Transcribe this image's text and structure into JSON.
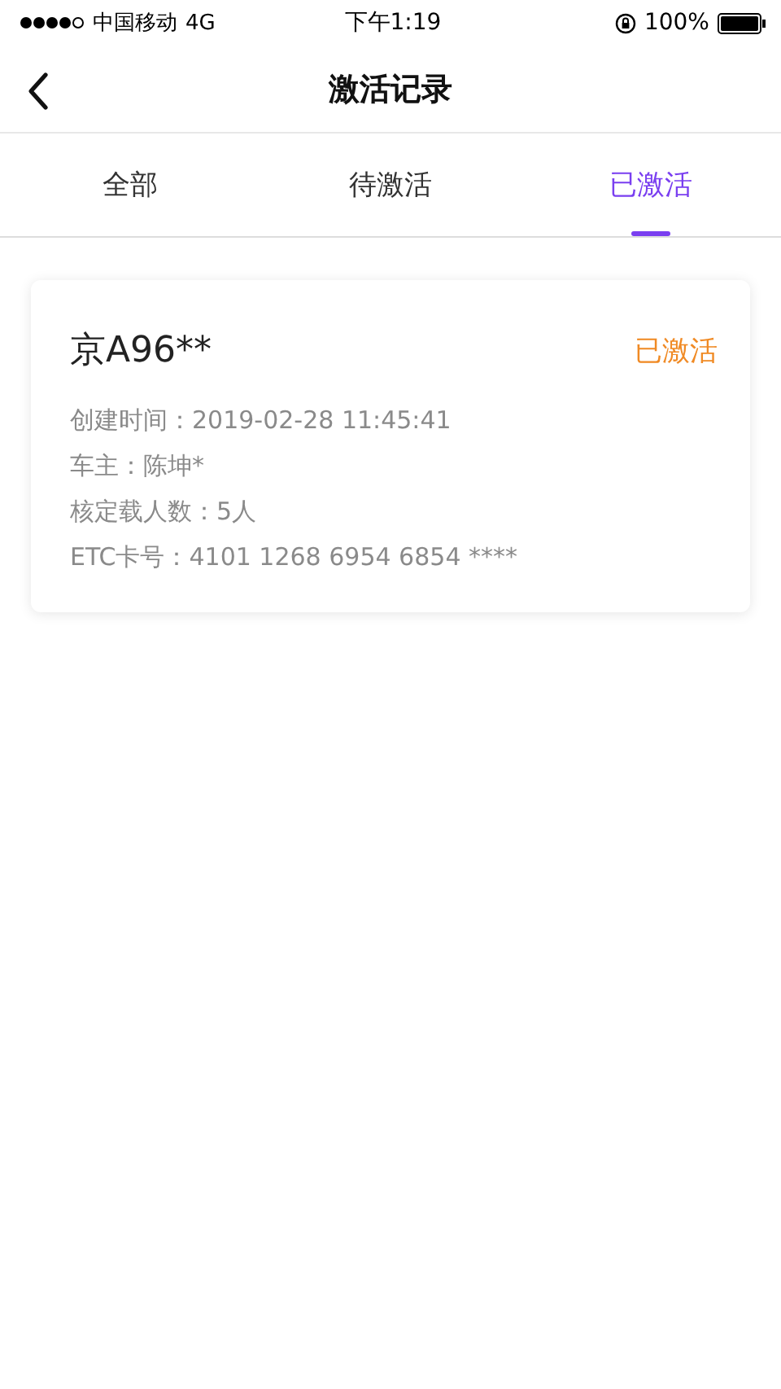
{
  "status_bar": {
    "carrier": "中国移动",
    "network": "4G",
    "time": "下午1:19",
    "battery": "100%"
  },
  "header": {
    "title": "激活记录"
  },
  "tabs": [
    {
      "label": "全部",
      "selected": false
    },
    {
      "label": "待激活",
      "selected": false
    },
    {
      "label": "已激活",
      "selected": true
    }
  ],
  "records": [
    {
      "plate": "京A96**",
      "status": "已激活",
      "details": [
        "创建时间：2019-02-28  11:45:41",
        "车主：陈坤*",
        "核定载人数：5人",
        "ETC卡号：4101 1268 6954 6854 ****"
      ]
    }
  ]
}
